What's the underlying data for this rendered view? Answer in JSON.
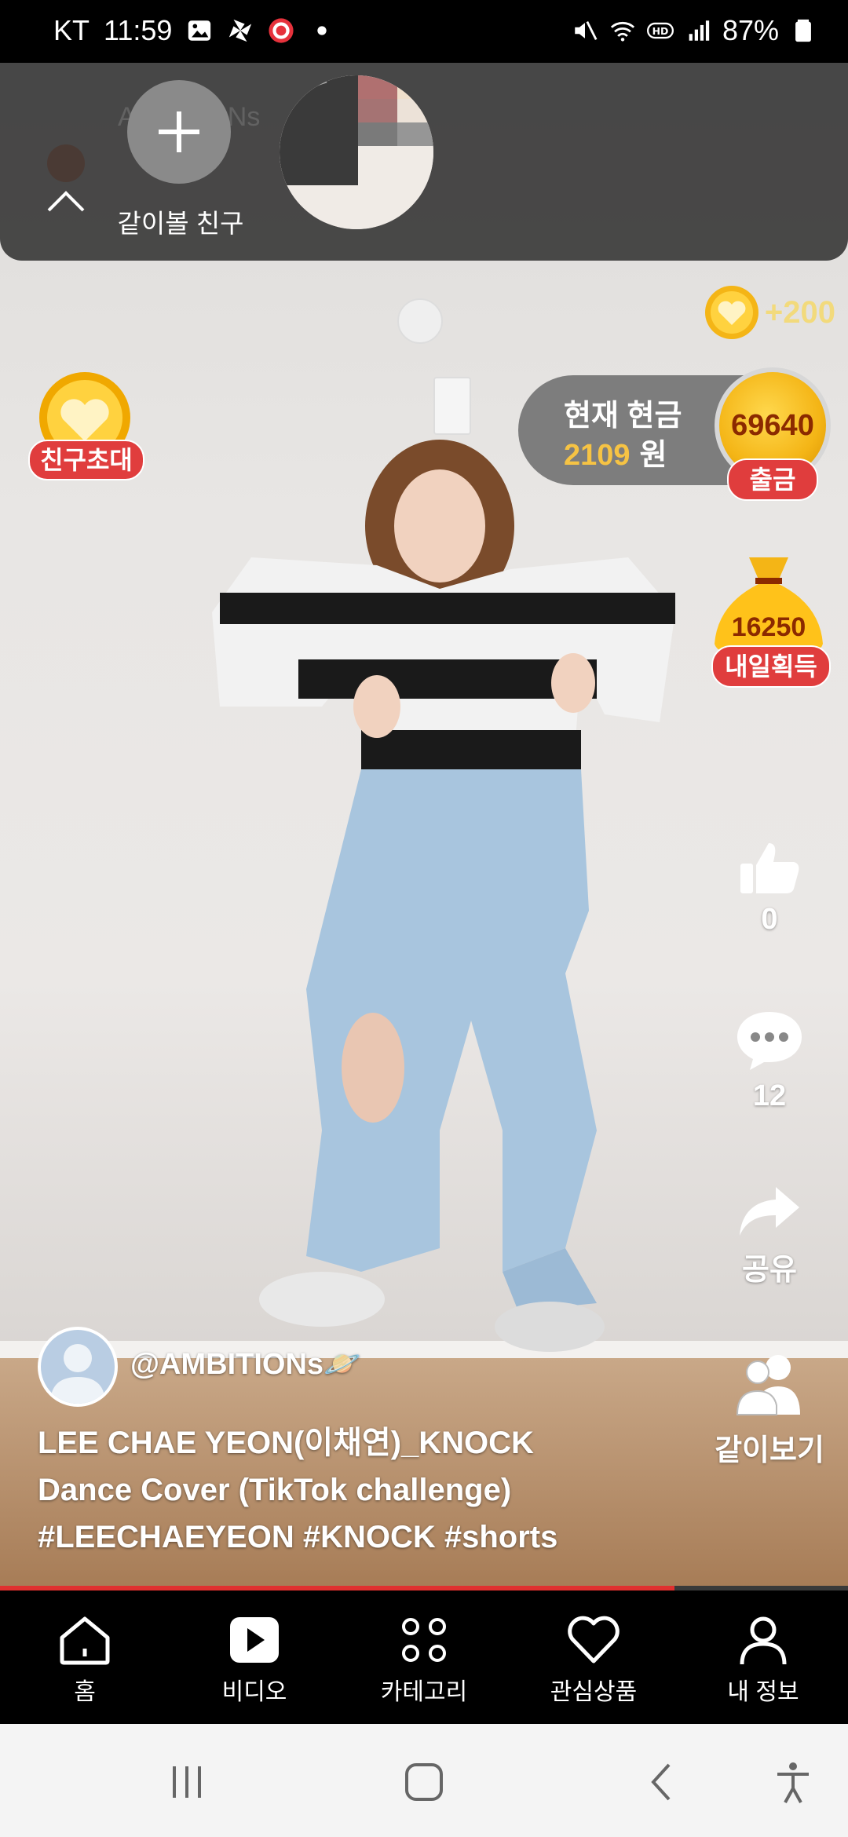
{
  "status_bar": {
    "carrier": "KT",
    "time": "11:59",
    "battery": "87%"
  },
  "top_panel": {
    "add_friend_label": "같이볼 친구",
    "faded_name": "AMBITIONs"
  },
  "rewards": {
    "coin_bonus": "+200",
    "invite_label": "친구초대",
    "cash_title": "현재 현금",
    "cash_amount": "2109",
    "cash_unit": "원",
    "coin_count": "69640",
    "withdraw_label": "출금",
    "tomorrow_amount": "16250",
    "tomorrow_label": "내일획득"
  },
  "actions": {
    "like_count": "0",
    "comment_count": "12",
    "share_label": "공유",
    "watch_together_label": "같이보기"
  },
  "video": {
    "author": "@AMBITIONs🪐",
    "caption_lines": [
      "LEE CHAE YEON(이채연)_KNOCK",
      "Dance Cover (TikTok challenge)",
      "#LEECHAEYEON #KNOCK #shorts"
    ],
    "progress_fraction": 0.795
  },
  "bottom_nav": [
    {
      "label": "홈",
      "icon": "home-icon"
    },
    {
      "label": "비디오",
      "icon": "video-play-icon"
    },
    {
      "label": "카테고리",
      "icon": "category-dots-icon"
    },
    {
      "label": "관심상품",
      "icon": "heart-icon"
    },
    {
      "label": "내 정보",
      "icon": "person-icon"
    }
  ],
  "colors": {
    "accent_red": "#e03d3d",
    "gold": "#f6c344",
    "progress": "#e0302f"
  }
}
